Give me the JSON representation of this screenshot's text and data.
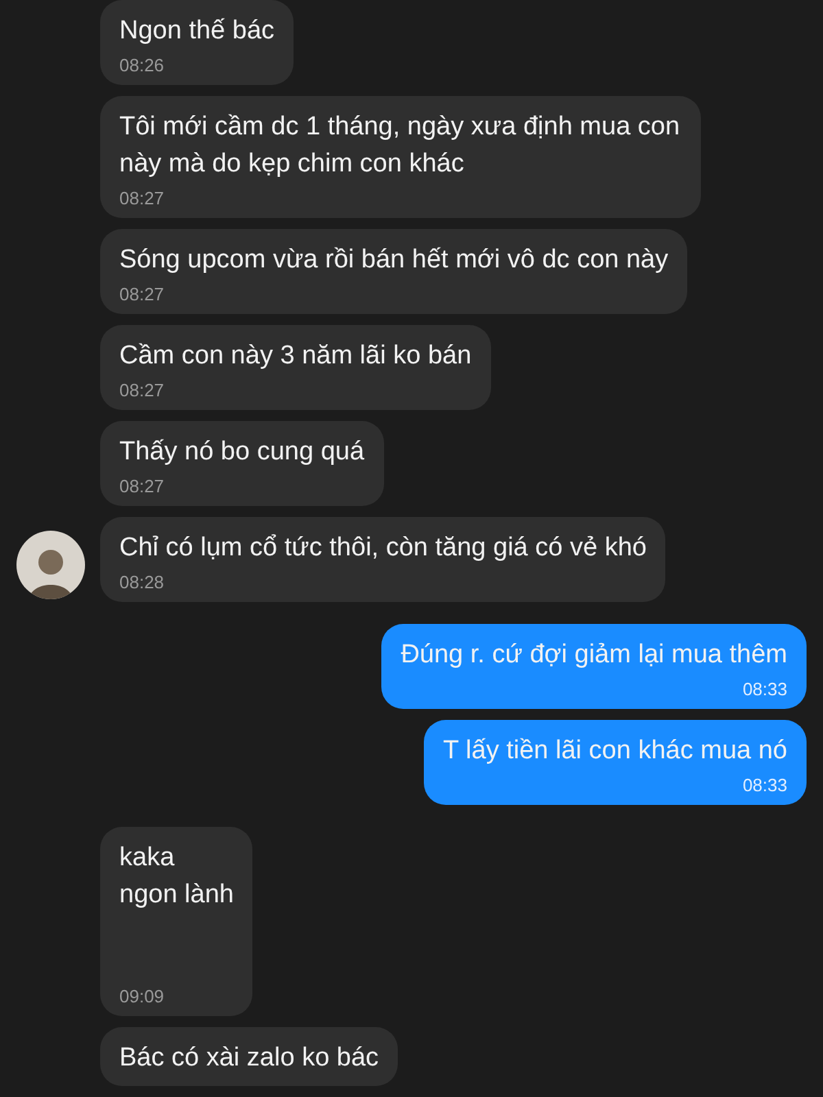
{
  "messages": [
    {
      "kind": "received",
      "text": "Ngon thế bác",
      "time": "08:26"
    },
    {
      "kind": "received",
      "text": "Tôi mới cầm dc 1 tháng, ngày xưa định mua con này mà do kẹp chim con khác",
      "time": "08:27"
    },
    {
      "kind": "received",
      "text": "Sóng upcom vừa rồi bán hết mới vô dc con này",
      "time": "08:27"
    },
    {
      "kind": "received",
      "text": "Cầm con này 3 năm lãi ko bán",
      "time": "08:27"
    },
    {
      "kind": "received",
      "text": "Thấy nó bo cung quá",
      "time": "08:27"
    },
    {
      "kind": "avatar",
      "text": "Chỉ có lụm cổ tức thôi, còn tăng giá có vẻ khó",
      "time": "08:28"
    },
    {
      "kind": "sent",
      "text": "Đúng r. cứ đợi giảm lại mua thêm",
      "time": "08:33"
    },
    {
      "kind": "sent",
      "text": "T lấy tiền lãi con khác mua nó",
      "time": "08:33"
    },
    {
      "kind": "received",
      "text": "kaka\nngon lành",
      "time": "09:09"
    },
    {
      "kind": "received",
      "text": "Bác có xài zalo ko bác"
    }
  ]
}
